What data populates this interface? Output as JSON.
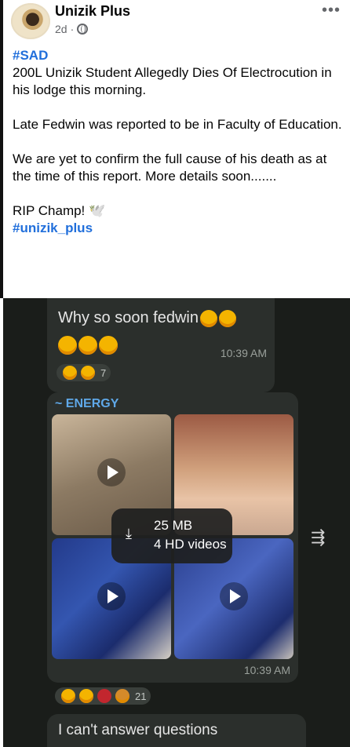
{
  "post": {
    "page_name": "Unizik Plus",
    "time_ago": "2d",
    "dot": "·",
    "privacy_icon": "globe-icon",
    "more_icon": "more-dots-icon",
    "more_glyph": "•••",
    "hashtag_top": "#SAD",
    "line1": "200L Unizik Student Allegedly Dies Of Electrocution in his lodge this morning.",
    "line2": "Late Fedwin was reported to be in Faculty of Education.",
    "line3": "We are yet to confirm the full cause of his death as at the time of this report. More details soon.......",
    "line4": "RIP Champ! 🕊️",
    "hashtag_bottom": "#unizik_plus",
    "link_color": "#216fdb"
  },
  "chat": {
    "msg1_text": "Why so soon fedwin",
    "msg1_time": "10:39 AM",
    "msg1_reaction_count": "7",
    "sender": "~ ENERGY",
    "download_size": "25 MB",
    "download_count": "4 HD videos",
    "msg2_time": "10:39 AM",
    "msg2_reaction_count": "21",
    "forward_glyph": "⇶",
    "msg3_text": "I can't answer questions",
    "sender_color": "#5fa8e8"
  }
}
